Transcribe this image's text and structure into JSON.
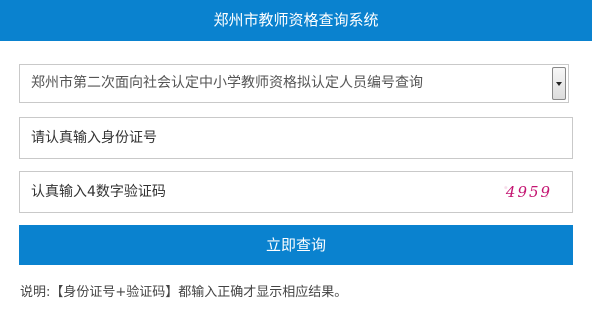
{
  "header": {
    "title": "郑州市教师资格查询系统"
  },
  "query_type": {
    "selected": "郑州市第二次面向社会认定中小学教师资格拟认定人员编号查询"
  },
  "id_field": {
    "placeholder": "请认真输入身份证号"
  },
  "captcha_field": {
    "placeholder": "认真输入4数字验证码",
    "captcha_value": "4959"
  },
  "submit": {
    "label": "立即查询"
  },
  "note": {
    "text": "说明:【身份证号+验证码】都输入正确才显示相应结果。"
  },
  "colors": {
    "primary": "#0a82cf",
    "captcha": "#c41471"
  }
}
